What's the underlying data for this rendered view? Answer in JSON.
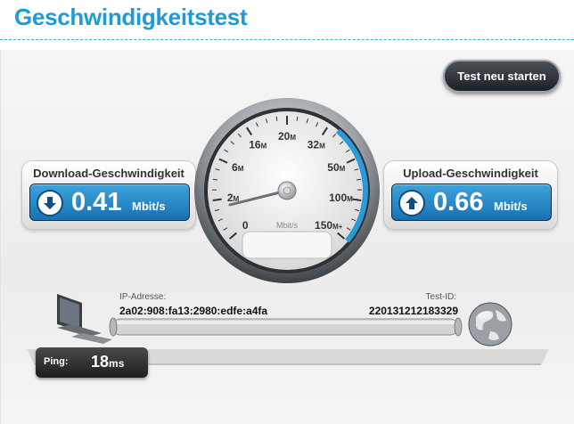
{
  "page": {
    "title": "Geschwindigkeitstest"
  },
  "toolbar": {
    "restart_label": "Test neu starten"
  },
  "download": {
    "label": "Download-Geschwindigkeit",
    "value": "0.41",
    "unit": "Mbit/s",
    "icon": "arrow-down-icon"
  },
  "upload": {
    "label": "Upload-Geschwindigkeit",
    "value": "0.66",
    "unit": "Mbit/s",
    "icon": "arrow-up-icon"
  },
  "gauge": {
    "unit_label": "Mbit/s",
    "ticks": [
      {
        "n": "0",
        "s": ""
      },
      {
        "n": "2",
        "s": "M"
      },
      {
        "n": "6",
        "s": "M"
      },
      {
        "n": "16",
        "s": "M"
      },
      {
        "n": "20",
        "s": "M"
      },
      {
        "n": "32",
        "s": "M"
      },
      {
        "n": "50",
        "s": "M"
      },
      {
        "n": "100",
        "s": "M"
      },
      {
        "n": "150",
        "s": "M+"
      }
    ],
    "needle_tick_fraction": 0.1,
    "accent_color": "#2a9ad8"
  },
  "connection": {
    "ip_label": "IP-Adresse:",
    "ip_value": "2a02:908:fa13:2980:edfe:a4fa",
    "test_id_label": "Test-ID:",
    "test_id_value": "220131212183329"
  },
  "ping": {
    "label": "Ping:",
    "value": "18",
    "unit": "ms"
  },
  "colors": {
    "title": "#1f9ad6",
    "value_box": "#1f86c6",
    "button": "#2a3035"
  }
}
